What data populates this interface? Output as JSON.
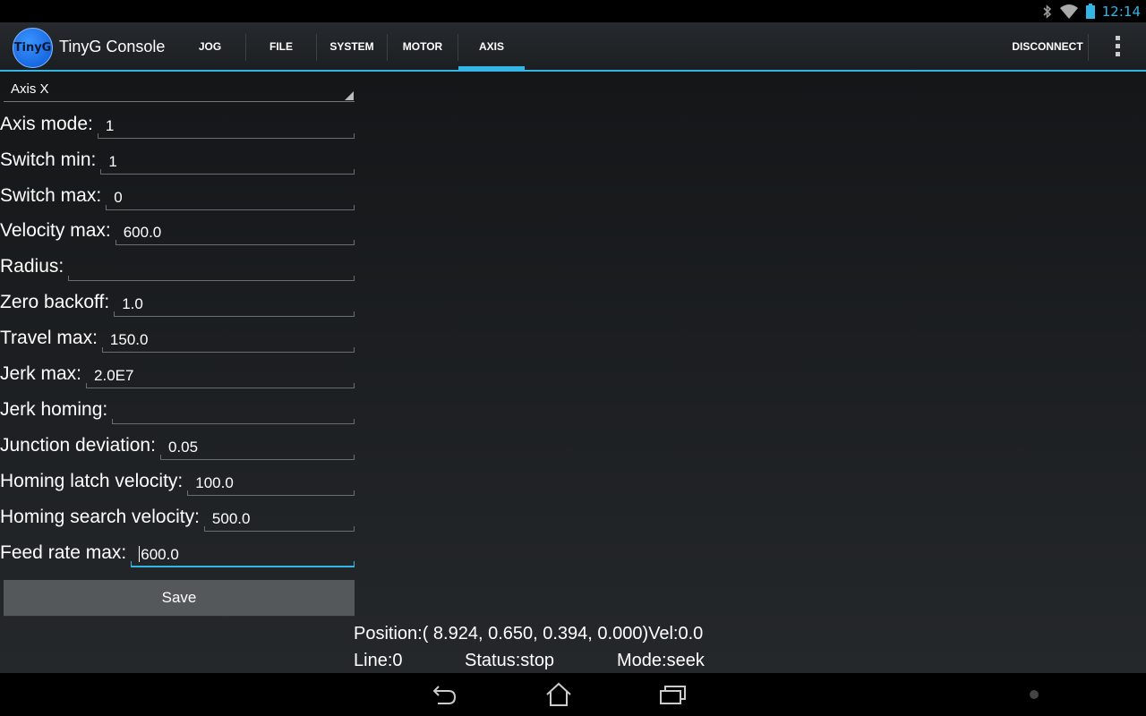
{
  "status_bar": {
    "time": "12:14",
    "icons": [
      "bluetooth-icon",
      "wifi-icon",
      "battery-icon"
    ]
  },
  "action_bar": {
    "logo_text": "TinyG",
    "app_title": "TinyG Console",
    "tabs": [
      {
        "label": "JOG",
        "active": false
      },
      {
        "label": "FILE",
        "active": false
      },
      {
        "label": "SYSTEM",
        "active": false
      },
      {
        "label": "MOTOR",
        "active": false
      },
      {
        "label": "AXIS",
        "active": true
      }
    ],
    "disconnect_label": "DISCONNECT",
    "overflow_icon": "overflow-menu-icon",
    "accent_color": "#33b5e5"
  },
  "axis_selector": {
    "selected": "Axis X"
  },
  "form": {
    "fields": [
      {
        "label": "Axis mode:",
        "value": "1"
      },
      {
        "label": "Switch min:",
        "value": "1"
      },
      {
        "label": "Switch max:",
        "value": "0"
      },
      {
        "label": "Velocity max:",
        "value": "600.0"
      },
      {
        "label": "Radius:",
        "value": ""
      },
      {
        "label": "Zero backoff:",
        "value": "1.0"
      },
      {
        "label": "Travel max:",
        "value": "150.0"
      },
      {
        "label": "Jerk max:",
        "value": "2.0E7"
      },
      {
        "label": "Jerk homing:",
        "value": ""
      },
      {
        "label": "Junction deviation:",
        "value": "0.05"
      },
      {
        "label": "Homing latch velocity:",
        "value": "100.0"
      },
      {
        "label": "Homing search velocity:",
        "value": "500.0"
      },
      {
        "label": "Feed rate max:",
        "value": "600.0"
      }
    ],
    "save_label": "Save"
  },
  "status": {
    "position": "Position:( 8.924, 0.650, 0.394, 0.000)Vel:0.0",
    "line": "Line:0",
    "state": "Status:stop",
    "mode": "Mode:seek"
  },
  "nav_bar": {
    "icons": [
      "back-icon",
      "home-icon",
      "recents-icon"
    ]
  }
}
